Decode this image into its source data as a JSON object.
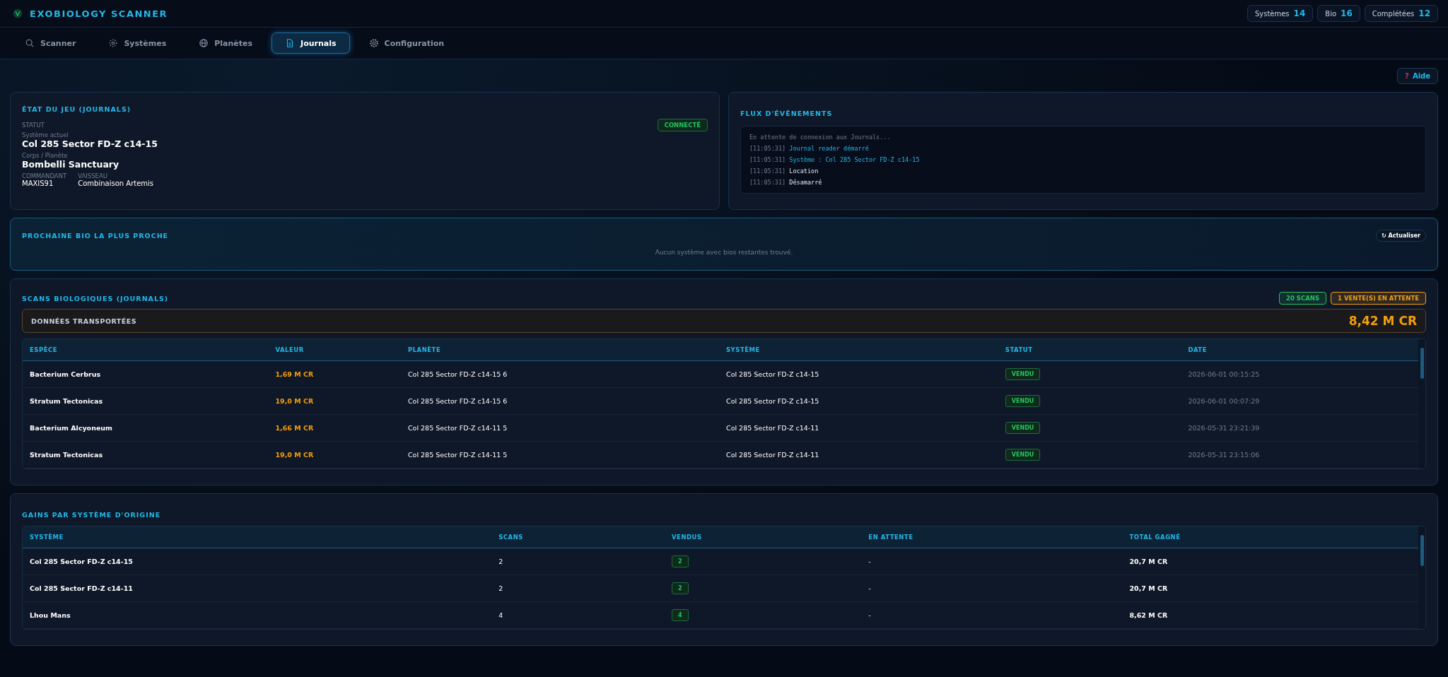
{
  "header": {
    "title": "EXOBIOLOGY SCANNER",
    "stats": [
      {
        "label": "Systèmes",
        "value": "14"
      },
      {
        "label": "Bio",
        "value": "16"
      },
      {
        "label": "Complétées",
        "value": "12"
      }
    ]
  },
  "tabs": [
    {
      "label": "Scanner",
      "kind": "search",
      "selected": false
    },
    {
      "label": "Systèmes",
      "kind": "orbit",
      "selected": false
    },
    {
      "label": "Planètes",
      "kind": "globe",
      "selected": false
    },
    {
      "label": "Journals",
      "kind": "document",
      "selected": true
    },
    {
      "label": "Configuration",
      "kind": "gear",
      "selected": false
    }
  ],
  "help_button": {
    "icon": "?",
    "label": "Aide"
  },
  "game_state": {
    "title": "ÉTAT DU JEU (JOURNALS)",
    "status_label": "STATUT",
    "status_badge": "CONNECTÉ",
    "connected": true,
    "fields": [
      {
        "label": "Système actuel",
        "value": "Col 285 Sector FD-Z c14-15"
      },
      {
        "label": "Corps / Planète",
        "value": "Bombelli Sanctuary"
      }
    ],
    "pairs": [
      {
        "label": "COMMANDANT",
        "value": "MAXIS91"
      },
      {
        "label": "VAISSEAU",
        "value": "Combinaison Artemis"
      }
    ]
  },
  "event_feed": {
    "title": "FLUX D'ÉVÉNEMENTS",
    "intro": "En attente de connexion aux Journals...",
    "events": [
      {
        "time": "[11:05:31]",
        "text": "Journal reader démarré",
        "highlight": true
      },
      {
        "time": "[11:05:31]",
        "text": "Système : Col 285 Sector FD-Z c14-15",
        "highlight": true
      },
      {
        "time": "[11:05:31]",
        "text": "Location",
        "highlight": false
      },
      {
        "time": "[11:05:31]",
        "text": "Désamarré",
        "highlight": false
      }
    ]
  },
  "nearest_bio": {
    "title": "PROCHAINE BIO LA PLUS PROCHE",
    "refresh_button": "↻ Actualiser",
    "message": "Aucun système avec bios restantes trouvé."
  },
  "bio_scans": {
    "title": "SCANS BIOLOGIQUES (JOURNALS)",
    "badges": [
      {
        "text": "20 SCANS",
        "color": "#22c55e"
      },
      {
        "text": "1 VENTE(S) EN ATTENTE",
        "color": "#f59e0b"
      }
    ],
    "carried_label": "DONNÉES TRANSPORTÉES",
    "carried_value": "8,42 M CR",
    "columns": [
      "ESPÈCE",
      "VALEUR",
      "PLANÈTE",
      "SYSTÈME",
      "STATUT",
      "DATE"
    ],
    "rows": [
      {
        "species": "Bacterium Cerbrus",
        "value": "1,69 M CR",
        "planet": "Col 285 Sector FD-Z c14-15 6",
        "system": "Col 285 Sector FD-Z c14-15",
        "status": "VENDU",
        "date": "2026-06-01 00:15:25"
      },
      {
        "species": "Stratum Tectonicas",
        "value": "19,0 M CR",
        "planet": "Col 285 Sector FD-Z c14-15 6",
        "system": "Col 285 Sector FD-Z c14-15",
        "status": "VENDU",
        "date": "2026-06-01 00:07:29"
      },
      {
        "species": "Bacterium Alcyoneum",
        "value": "1,66 M CR",
        "planet": "Col 285 Sector FD-Z c14-11 5",
        "system": "Col 285 Sector FD-Z c14-11",
        "status": "VENDU",
        "date": "2026-05-31 23:21:39"
      },
      {
        "species": "Stratum Tectonicas",
        "value": "19,0 M CR",
        "planet": "Col 285 Sector FD-Z c14-11 5",
        "system": "Col 285 Sector FD-Z c14-11",
        "status": "VENDU",
        "date": "2026-05-31 23:15:06"
      }
    ]
  },
  "gains": {
    "title": "GAINS PAR SYSTÈME D'ORIGINE",
    "columns": [
      "SYSTÈME",
      "SCANS",
      "VENDUS",
      "EN ATTENTE",
      "TOTAL GAGNÉ"
    ],
    "rows": [
      {
        "system": "Col 285 Sector FD-Z c14-15",
        "scans": "2",
        "sold": "2",
        "pending": "-",
        "total": "20,7 M CR"
      },
      {
        "system": "Col 285 Sector FD-Z c14-11",
        "scans": "2",
        "sold": "2",
        "pending": "-",
        "total": "20,7 M CR"
      },
      {
        "system": "Lhou Mans",
        "scans": "4",
        "sold": "4",
        "pending": "-",
        "total": "8,62 M CR"
      }
    ]
  }
}
